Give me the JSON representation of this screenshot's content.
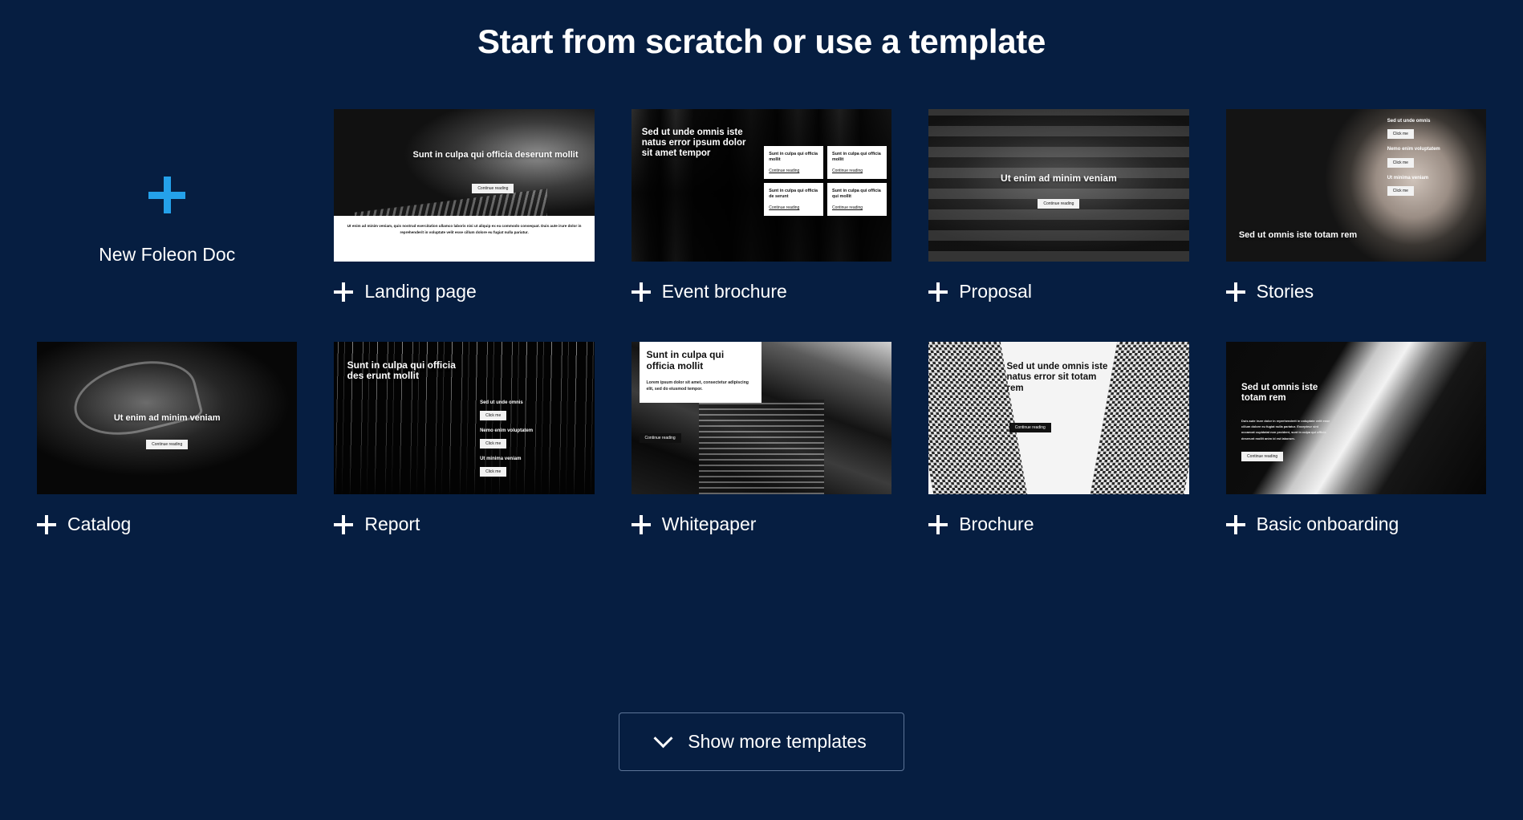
{
  "page": {
    "title": "Start from scratch or use a template",
    "background_color": "#061e41",
    "accent_color": "#24a1ea"
  },
  "new_doc": {
    "label": "New Foleon Doc",
    "icon": "plus-icon"
  },
  "templates": [
    {
      "id": "landing-page",
      "label": "Landing page",
      "heading": "Sunt in culpa qui officia deserunt mollit",
      "button": "Continue reading",
      "body": "Ut enim ad minim veniam, quis nostrud exercitation ullamco laboris nisi ut aliquip ex ea commodo consequat. Duis aute irure dolor in reprehenderit in voluptate velit esse cillum dolore eu fugiat nulla pariatur."
    },
    {
      "id": "event-brochure",
      "label": "Event brochure",
      "heading": "Sed ut unde omnis iste natus error ipsum dolor sit amet tempor",
      "cards": [
        {
          "title": "Sunt in culpa qui officia mollit",
          "link": "Continue reading"
        },
        {
          "title": "Sunt in culpa qui officia mollit",
          "link": "Continue reading"
        },
        {
          "title": "Sunt in culpa qui officia de serunt",
          "link": "Continue reading"
        },
        {
          "title": "Sunt in culpa qui officia qui mollit",
          "link": "Continue reading"
        }
      ]
    },
    {
      "id": "proposal",
      "label": "Proposal",
      "heading": "Ut enim ad minim veniam",
      "button": "Continue reading"
    },
    {
      "id": "stories",
      "label": "Stories",
      "heading": "Sed ut omnis iste totam rem",
      "sidebar": [
        {
          "title": "Sed ut unde omnis",
          "button": "Click me"
        },
        {
          "title": "Nemo enim voluptatem",
          "button": "Click me"
        },
        {
          "title": "Ut minima veniam",
          "button": "Click me"
        }
      ]
    },
    {
      "id": "catalog",
      "label": "Catalog",
      "heading": "Ut enim ad minim veniam",
      "button": "Continue reading"
    },
    {
      "id": "report",
      "label": "Report",
      "heading": "Sunt in culpa qui officia des erunt mollit",
      "sidebar": [
        {
          "title": "Sed ut unde omnis",
          "button": "Click me"
        },
        {
          "title": "Nemo enim voluptatem",
          "button": "Click me"
        },
        {
          "title": "Ut minima veniam",
          "button": "Click me"
        }
      ]
    },
    {
      "id": "whitepaper",
      "label": "Whitepaper",
      "heading": "Sunt in culpa qui officia mollit",
      "body": "Lorem ipsum dolor sit amet, consectetur adipiscing elit, sed do eiusmod tempor.",
      "button": "Continue reading"
    },
    {
      "id": "brochure",
      "label": "Brochure",
      "heading": "Sed ut unde omnis iste natus error sit totam rem",
      "button": "Continue reading"
    },
    {
      "id": "basic-onboarding",
      "label": "Basic onboarding",
      "heading": "Sed ut omnis iste totam rem",
      "body": "Duis aute irure dolor in reprehenderit in voluptate velit esse cillum dolore eu fugiat nulla pariatur. Excepteur sint occaecat cupidatat non proident, sunt in culpa qui officia deserunt mollit anim id est laborum.",
      "button": "Continue reading"
    }
  ],
  "show_more": {
    "label": "Show more templates",
    "icon": "chevron-down-icon"
  }
}
